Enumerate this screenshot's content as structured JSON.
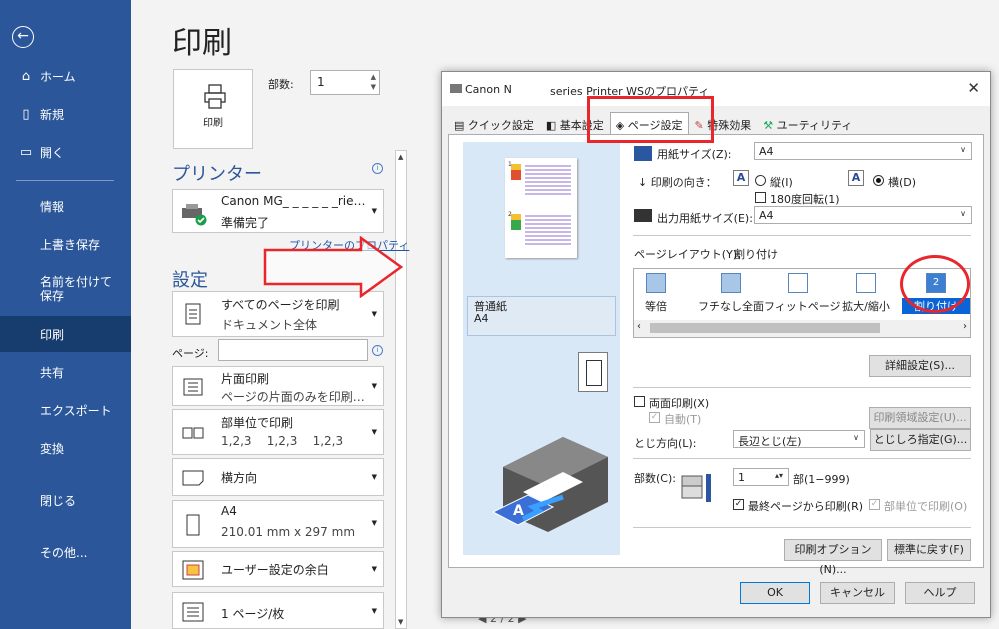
{
  "sidebar": {
    "items": [
      {
        "label": "ホーム",
        "icon": "home-icon"
      },
      {
        "label": "新規",
        "icon": "new-document-icon"
      },
      {
        "label": "開く",
        "icon": "folder-open-icon"
      },
      {
        "label": "情報"
      },
      {
        "label": "上書き保存"
      },
      {
        "label": "名前を付けて保存"
      },
      {
        "label": "印刷",
        "selected": true
      },
      {
        "label": "共有"
      },
      {
        "label": "エクスポート"
      },
      {
        "label": "変換"
      },
      {
        "label": "閉じる"
      },
      {
        "label": "その他..."
      }
    ]
  },
  "main": {
    "title": "印刷",
    "print_button": "印刷",
    "copies_label": "部数:",
    "copies_value": "1",
    "printer_heading": "プリンター",
    "printer_name": "Canon MG_ _ _ _ _ _rie…",
    "printer_status": "準備完了",
    "printer_properties_link": "プリンターのプロパティ",
    "settings_heading": "設定",
    "settings": [
      {
        "line1": "すべてのページを印刷",
        "line2": "ドキュメント全体",
        "icon": "document-pages-icon"
      },
      {
        "line1": "片面印刷",
        "line2": "ページの片面のみを印刷…",
        "icon": "one-sided-icon"
      },
      {
        "line1": "部単位で印刷",
        "line2": "1,2,3    1,2,3    1,2,3",
        "icon": "collate-icon"
      },
      {
        "line1": "横方向",
        "line2": "",
        "icon": "landscape-icon"
      },
      {
        "line1": "A4",
        "line2": "210.01 mm x 297 mm",
        "icon": "paper-size-icon"
      },
      {
        "line1": "ユーザー設定の余白",
        "line2": "",
        "icon": "margins-icon"
      },
      {
        "line1": "1 ページ/枚",
        "line2": "",
        "icon": "pages-per-sheet-icon"
      }
    ],
    "pages_label": "ページ:",
    "pages_value": "",
    "page_nav": "◀ 2     / 2 ▶"
  },
  "dialog": {
    "title_left": "Canon N",
    "title_right": "series Printer WSのプロパティ",
    "close": "✕",
    "tabs": [
      {
        "label": "クイック設定",
        "icon": "quick-setup-icon"
      },
      {
        "label": "基本設定",
        "icon": "main-settings-icon"
      },
      {
        "label": "ページ設定",
        "icon": "page-setup-icon",
        "selected": true
      },
      {
        "label": "特殊効果",
        "icon": "effects-icon"
      },
      {
        "label": "ユーティリティ",
        "icon": "utility-icon"
      }
    ],
    "preview_paper": "普通紙",
    "preview_size": "A4",
    "paper_size_label": "用紙サイズ(Z):",
    "paper_size_value": "A4",
    "orientation_label": "印刷の向き：",
    "portrait_label": "縦(I)",
    "landscape_label": "横(D)",
    "rotate180_label": "180度回転(1)",
    "output_size_label": "出力用紙サイズ(E):",
    "output_size_value": "A4",
    "page_layout_label": "ページレイアウト(Y):",
    "page_layout_value": "割り付け",
    "layouts": [
      {
        "label": "等倍"
      },
      {
        "label": "フチなし全面"
      },
      {
        "label": "フィットページ"
      },
      {
        "label": "拡大/縮小"
      },
      {
        "label": "割り付け",
        "selected": true,
        "badge": "2"
      }
    ],
    "details_button": "詳細設定(S)...",
    "duplex_label": "両面印刷(X)",
    "auto_label": "自動(T)",
    "print_area_button": "印刷領域設定(U)...",
    "binding_side_label": "とじ方向(L):",
    "binding_side_value": "長辺とじ(左)",
    "binding_margin_button": "とじしろ指定(G)...",
    "copies_label": "部数(C):",
    "copies_value": "1",
    "copies_range": "部(1−999)",
    "last_page_first_label": "最終ページから印刷(R)",
    "collate_label": "部単位で印刷(O)",
    "print_options_button": "印刷オプション(N)...",
    "defaults_button": "標準に戻す(F)",
    "ok_button": "OK",
    "cancel_button": "キャンセル",
    "help_button": "ヘルプ"
  },
  "colors": {
    "sidebar": "#2b579a",
    "annotation_red": "#e8262c",
    "accent": "#2b579a"
  }
}
